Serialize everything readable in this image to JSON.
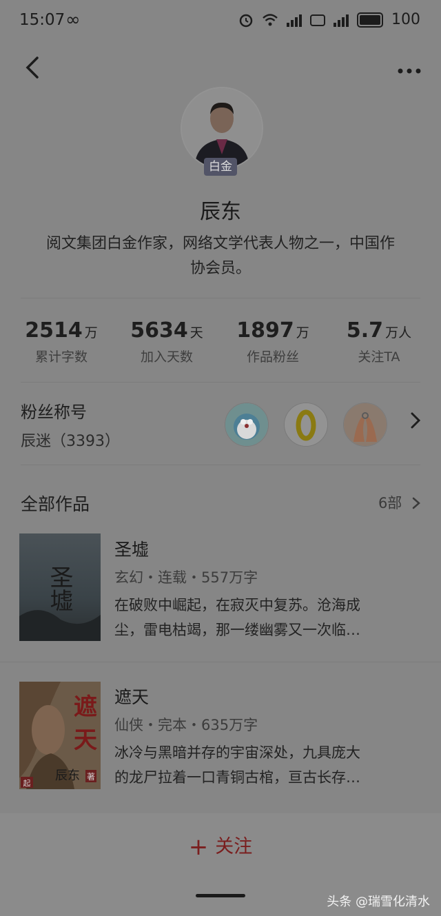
{
  "status_bar": {
    "time": "15:07",
    "loop_icon": "∞",
    "battery": "100"
  },
  "nav": {
    "back_icon": "chevron-left",
    "more_icon": "more-dots"
  },
  "author": {
    "badge": "白金",
    "name": "辰东",
    "bio_line1": "阅文集团白金作家，网络文学代表人物之一，中国作",
    "bio_line2": "协会员。"
  },
  "stats": [
    {
      "value": "2514",
      "unit": "万",
      "label": "累计字数"
    },
    {
      "value": "5634",
      "unit": "天",
      "label": "加入天数"
    },
    {
      "value": "1897",
      "unit": "万",
      "label": "作品粉丝"
    },
    {
      "value": "5.7",
      "unit": "万人",
      "label": "关注TA"
    }
  ],
  "fans": {
    "title": "粉丝称号",
    "subtitle": "辰迷（3393）"
  },
  "works": {
    "title": "全部作品",
    "count": "6部",
    "books": [
      {
        "title": "圣墟",
        "meta": "玄幻・连载・557万字",
        "desc_line1": "在破败中崛起，在寂灭中复苏。沧海成",
        "desc_line2": "尘，雷电枯竭，那一缕幽雾又一次临…",
        "cover_text": "圣墟"
      },
      {
        "title": "遮天",
        "meta": "仙侠・完本・635万字",
        "desc_line1": "冰冷与黑暗并存的宇宙深处，九具庞大",
        "desc_line2": "的龙尸拉着一口青铜古棺，亘古长存…",
        "cover_text_1": "遮",
        "cover_text_2": "天",
        "cover_author": "辰东",
        "cover_mark": "著",
        "cover_logo": "起"
      }
    ]
  },
  "follow": {
    "plus": "+",
    "label": "关注"
  },
  "watermark": "头条 @瑞雪化清水",
  "colors": {
    "accent": "#7a1e1e",
    "badge_bg": "#525467"
  }
}
